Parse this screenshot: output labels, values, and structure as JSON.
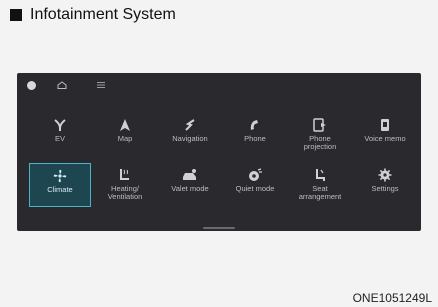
{
  "header": {
    "title": "Infotainment System"
  },
  "screen": {
    "tiles": [
      {
        "label": "EV",
        "icon": "ev-plug-icon"
      },
      {
        "label": "Map",
        "icon": "map-arrow-icon"
      },
      {
        "label": "Navigation",
        "icon": "navigation-icon"
      },
      {
        "label": "Phone",
        "icon": "phone-icon"
      },
      {
        "label": "Phone\nprojection",
        "icon": "phone-projection-icon"
      },
      {
        "label": "Voice memo",
        "icon": "voice-memo-icon"
      },
      {
        "label": "Climate",
        "icon": "climate-fan-icon",
        "selected": true
      },
      {
        "label": "Heating/\nVentilation",
        "icon": "seat-heating-icon"
      },
      {
        "label": "Valet mode",
        "icon": "valet-mode-icon"
      },
      {
        "label": "Quiet mode",
        "icon": "quiet-mode-icon"
      },
      {
        "label": "Seat\narrangement",
        "icon": "seat-arrangement-icon"
      },
      {
        "label": "Settings",
        "icon": "settings-gear-icon"
      }
    ]
  },
  "caption": "ONE1051249L"
}
